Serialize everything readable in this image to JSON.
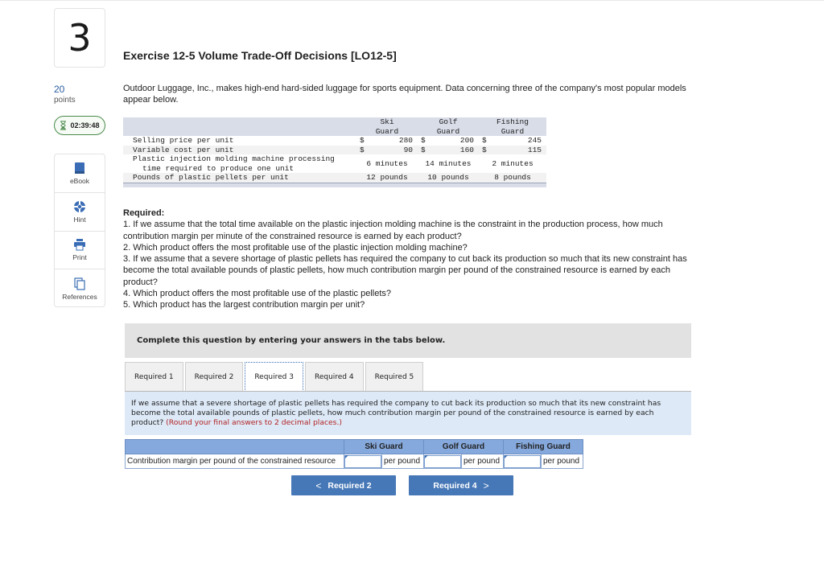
{
  "question": {
    "number": "3",
    "points_value": "20",
    "points_label": "points",
    "timer": "02:39:48"
  },
  "tools": [
    {
      "label": "eBook",
      "icon": "book-icon"
    },
    {
      "label": "Hint",
      "icon": "lifebuoy-icon"
    },
    {
      "label": "Print",
      "icon": "printer-icon"
    },
    {
      "label": "References",
      "icon": "copy-icon"
    }
  ],
  "title": "Exercise 12-5 Volume Trade-Off Decisions [LO12-5]",
  "intro": "Outdoor Luggage, Inc., makes high-end hard-sided luggage for sports equipment. Data concerning three of the company's most popular models appear below.",
  "data_table": {
    "headers": [
      {
        "line1": "Ski",
        "line2": "Guard"
      },
      {
        "line1": "Golf",
        "line2": "Guard"
      },
      {
        "line1": "Fishing",
        "line2": "Guard"
      }
    ],
    "rows": [
      {
        "label": "Selling price per unit",
        "currency": "$",
        "values": [
          "280",
          "200",
          "245"
        ]
      },
      {
        "label": "Variable cost per unit",
        "currency": "$",
        "values": [
          "90",
          "160",
          "115"
        ]
      },
      {
        "label_line1": "Plastic injection molding machine processing",
        "label_line2": "time required to produce one unit",
        "values": [
          "6 minutes",
          "14 minutes",
          "2 minutes"
        ]
      },
      {
        "label": "Pounds of plastic pellets per unit",
        "values": [
          "12 pounds",
          "10 pounds",
          "8 pounds"
        ]
      }
    ]
  },
  "required": {
    "heading": "Required:",
    "items": [
      "1. If we assume that the total time available on the plastic injection molding machine is the constraint in the production process, how much contribution margin per minute of the constrained resource is earned by each product?",
      "2. Which product offers the most profitable use of the plastic injection molding machine?",
      "3. If we assume that a severe shortage of plastic pellets has required the company to cut back its production so much that its new constraint has become the total available pounds of plastic pellets, how much contribution margin per pound of the constrained resource is earned by each product?",
      "4. Which product offers the most profitable use of the plastic pellets?",
      "5. Which product has the largest contribution margin per unit?"
    ]
  },
  "complete_banner": "Complete this question by entering your answers in the tabs below.",
  "tabs": [
    {
      "label": "Required 1",
      "active": false
    },
    {
      "label": "Required 2",
      "active": false
    },
    {
      "label": "Required 3",
      "active": true
    },
    {
      "label": "Required 4",
      "active": false
    },
    {
      "label": "Required 5",
      "active": false
    }
  ],
  "prompt": {
    "text": "If we assume that a severe shortage of plastic pellets has required the company to cut back its production so much that its new constraint has become the total available pounds of plastic pellets, how much contribution margin per pound of the constrained resource is earned by each product?",
    "note": "(Round your final answers to 2 decimal places.)"
  },
  "answer_table": {
    "columns": [
      "Ski Guard",
      "Golf Guard",
      "Fishing Guard"
    ],
    "row_label": "Contribution margin per pound of the constrained resource",
    "unit": "per pound",
    "values": [
      "",
      "",
      ""
    ]
  },
  "nav": {
    "prev_label": "Required 2",
    "next_label": "Required 4",
    "prev_glyph": "<",
    "next_glyph": ">"
  }
}
